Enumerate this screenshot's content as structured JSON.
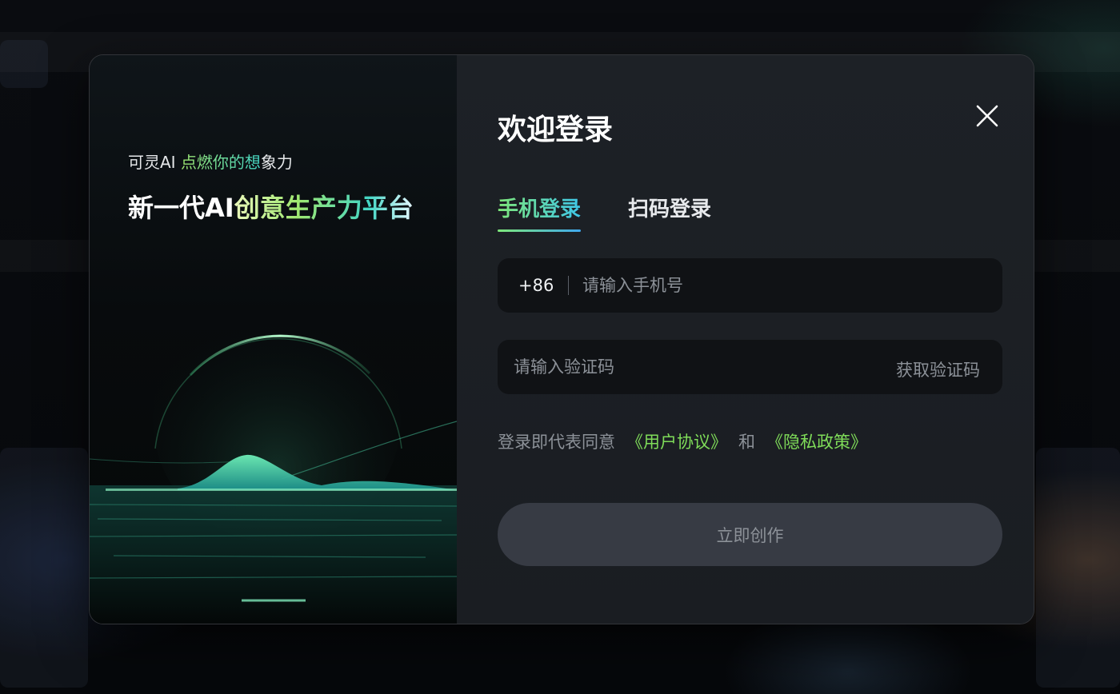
{
  "left": {
    "slogan_small_prefix": "可灵AI ",
    "slogan_small_highlight": "点燃你的想",
    "slogan_small_suffix": "象力",
    "slogan_big_prefix": "新一代AI",
    "slogan_big_highlight": "创意生产力平台"
  },
  "login": {
    "title": "欢迎登录",
    "tabs": [
      {
        "label": "手机登录",
        "active": true
      },
      {
        "label": "扫码登录",
        "active": false
      }
    ],
    "phone": {
      "prefix": "+86",
      "placeholder": "请输入手机号",
      "value": ""
    },
    "code": {
      "placeholder": "请输入验证码",
      "value": "",
      "get_code_label": "获取验证码"
    },
    "agreement": {
      "text": "登录即代表同意",
      "user_agreement": "《用户协议》",
      "conjunction": "和",
      "privacy_policy": "《隐私政策》"
    },
    "submit_label": "立即创作"
  },
  "colors": {
    "accent_green": "#7fdc59",
    "accent_cyan": "#3fc6e8",
    "panel_bg": "#1b1e23",
    "input_bg": "#101215",
    "button_disabled_bg": "#373b44"
  }
}
